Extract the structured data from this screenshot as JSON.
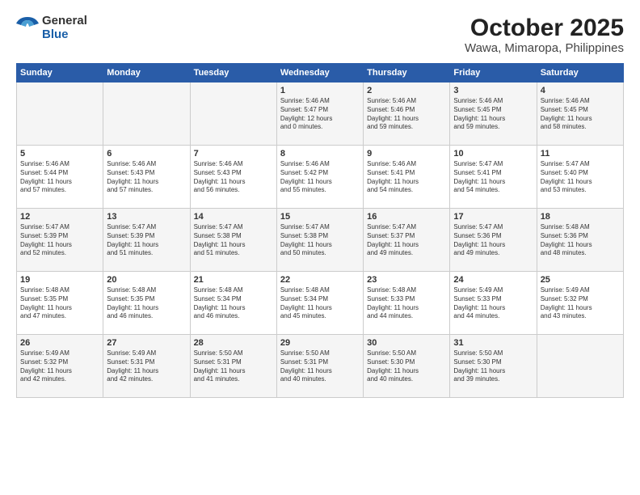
{
  "logo": {
    "general": "General",
    "blue": "Blue"
  },
  "title": "October 2025",
  "subtitle": "Wawa, Mimaropa, Philippines",
  "days_of_week": [
    "Sunday",
    "Monday",
    "Tuesday",
    "Wednesday",
    "Thursday",
    "Friday",
    "Saturday"
  ],
  "weeks": [
    [
      {
        "day": "",
        "text": ""
      },
      {
        "day": "",
        "text": ""
      },
      {
        "day": "",
        "text": ""
      },
      {
        "day": "1",
        "text": "Sunrise: 5:46 AM\nSunset: 5:47 PM\nDaylight: 12 hours\nand 0 minutes."
      },
      {
        "day": "2",
        "text": "Sunrise: 5:46 AM\nSunset: 5:46 PM\nDaylight: 11 hours\nand 59 minutes."
      },
      {
        "day": "3",
        "text": "Sunrise: 5:46 AM\nSunset: 5:45 PM\nDaylight: 11 hours\nand 59 minutes."
      },
      {
        "day": "4",
        "text": "Sunrise: 5:46 AM\nSunset: 5:45 PM\nDaylight: 11 hours\nand 58 minutes."
      }
    ],
    [
      {
        "day": "5",
        "text": "Sunrise: 5:46 AM\nSunset: 5:44 PM\nDaylight: 11 hours\nand 57 minutes."
      },
      {
        "day": "6",
        "text": "Sunrise: 5:46 AM\nSunset: 5:43 PM\nDaylight: 11 hours\nand 57 minutes."
      },
      {
        "day": "7",
        "text": "Sunrise: 5:46 AM\nSunset: 5:43 PM\nDaylight: 11 hours\nand 56 minutes."
      },
      {
        "day": "8",
        "text": "Sunrise: 5:46 AM\nSunset: 5:42 PM\nDaylight: 11 hours\nand 55 minutes."
      },
      {
        "day": "9",
        "text": "Sunrise: 5:46 AM\nSunset: 5:41 PM\nDaylight: 11 hours\nand 54 minutes."
      },
      {
        "day": "10",
        "text": "Sunrise: 5:47 AM\nSunset: 5:41 PM\nDaylight: 11 hours\nand 54 minutes."
      },
      {
        "day": "11",
        "text": "Sunrise: 5:47 AM\nSunset: 5:40 PM\nDaylight: 11 hours\nand 53 minutes."
      }
    ],
    [
      {
        "day": "12",
        "text": "Sunrise: 5:47 AM\nSunset: 5:39 PM\nDaylight: 11 hours\nand 52 minutes."
      },
      {
        "day": "13",
        "text": "Sunrise: 5:47 AM\nSunset: 5:39 PM\nDaylight: 11 hours\nand 51 minutes."
      },
      {
        "day": "14",
        "text": "Sunrise: 5:47 AM\nSunset: 5:38 PM\nDaylight: 11 hours\nand 51 minutes."
      },
      {
        "day": "15",
        "text": "Sunrise: 5:47 AM\nSunset: 5:38 PM\nDaylight: 11 hours\nand 50 minutes."
      },
      {
        "day": "16",
        "text": "Sunrise: 5:47 AM\nSunset: 5:37 PM\nDaylight: 11 hours\nand 49 minutes."
      },
      {
        "day": "17",
        "text": "Sunrise: 5:47 AM\nSunset: 5:36 PM\nDaylight: 11 hours\nand 49 minutes."
      },
      {
        "day": "18",
        "text": "Sunrise: 5:48 AM\nSunset: 5:36 PM\nDaylight: 11 hours\nand 48 minutes."
      }
    ],
    [
      {
        "day": "19",
        "text": "Sunrise: 5:48 AM\nSunset: 5:35 PM\nDaylight: 11 hours\nand 47 minutes."
      },
      {
        "day": "20",
        "text": "Sunrise: 5:48 AM\nSunset: 5:35 PM\nDaylight: 11 hours\nand 46 minutes."
      },
      {
        "day": "21",
        "text": "Sunrise: 5:48 AM\nSunset: 5:34 PM\nDaylight: 11 hours\nand 46 minutes."
      },
      {
        "day": "22",
        "text": "Sunrise: 5:48 AM\nSunset: 5:34 PM\nDaylight: 11 hours\nand 45 minutes."
      },
      {
        "day": "23",
        "text": "Sunrise: 5:48 AM\nSunset: 5:33 PM\nDaylight: 11 hours\nand 44 minutes."
      },
      {
        "day": "24",
        "text": "Sunrise: 5:49 AM\nSunset: 5:33 PM\nDaylight: 11 hours\nand 44 minutes."
      },
      {
        "day": "25",
        "text": "Sunrise: 5:49 AM\nSunset: 5:32 PM\nDaylight: 11 hours\nand 43 minutes."
      }
    ],
    [
      {
        "day": "26",
        "text": "Sunrise: 5:49 AM\nSunset: 5:32 PM\nDaylight: 11 hours\nand 42 minutes."
      },
      {
        "day": "27",
        "text": "Sunrise: 5:49 AM\nSunset: 5:31 PM\nDaylight: 11 hours\nand 42 minutes."
      },
      {
        "day": "28",
        "text": "Sunrise: 5:50 AM\nSunset: 5:31 PM\nDaylight: 11 hours\nand 41 minutes."
      },
      {
        "day": "29",
        "text": "Sunrise: 5:50 AM\nSunset: 5:31 PM\nDaylight: 11 hours\nand 40 minutes."
      },
      {
        "day": "30",
        "text": "Sunrise: 5:50 AM\nSunset: 5:30 PM\nDaylight: 11 hours\nand 40 minutes."
      },
      {
        "day": "31",
        "text": "Sunrise: 5:50 AM\nSunset: 5:30 PM\nDaylight: 11 hours\nand 39 minutes."
      },
      {
        "day": "",
        "text": ""
      }
    ]
  ]
}
